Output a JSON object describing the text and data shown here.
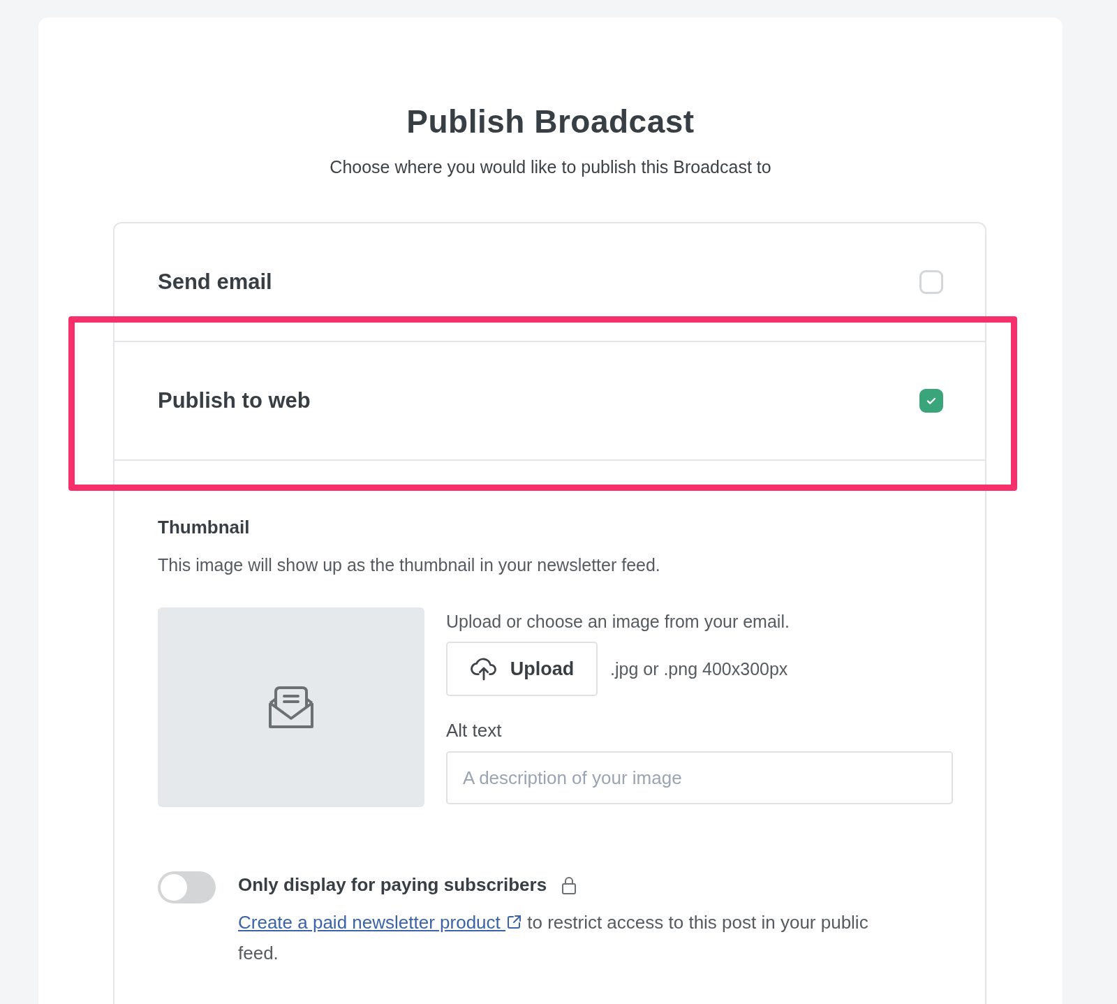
{
  "title": "Publish Broadcast",
  "subtitle": "Choose where you would like to publish this Broadcast to",
  "options": [
    {
      "label": "Send email",
      "checked": false
    },
    {
      "label": "Publish to web",
      "checked": true
    }
  ],
  "thumbnail": {
    "heading": "Thumbnail",
    "description": "This image will show up as the thumbnail in your newsletter feed.",
    "upload_hint": "Upload or choose an image from your email.",
    "upload_button": "Upload",
    "format_hint": ".jpg or .png 400x300px",
    "alt_label": "Alt text",
    "alt_placeholder": "A description of your image"
  },
  "paywall": {
    "on": false,
    "label": "Only display for paying subscribers",
    "link": "Create a paid newsletter product",
    "note": "to restrict access to this post in your public feed."
  }
}
